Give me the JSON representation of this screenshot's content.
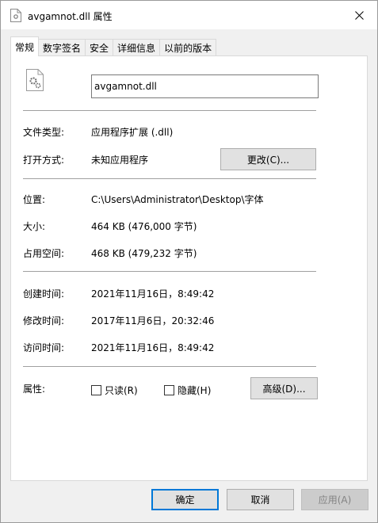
{
  "window": {
    "title": "avgamnot.dll 属性",
    "close_icon": "close-icon"
  },
  "tabs": [
    {
      "label": "常规",
      "active": true
    },
    {
      "label": "数字签名",
      "active": false
    },
    {
      "label": "安全",
      "active": false
    },
    {
      "label": "详细信息",
      "active": false
    },
    {
      "label": "以前的版本",
      "active": false
    }
  ],
  "general": {
    "filename": "avgamnot.dll",
    "file_type_label": "文件类型:",
    "file_type_value": "应用程序扩展 (.dll)",
    "opens_with_label": "打开方式:",
    "opens_with_value": "未知应用程序",
    "change_button": "更改(C)...",
    "location_label": "位置:",
    "location_value": "C:\\Users\\Administrator\\Desktop\\字体",
    "size_label": "大小:",
    "size_value": "464 KB (476,000 字节)",
    "disk_size_label": "占用空间:",
    "disk_size_value": "468 KB (479,232 字节)",
    "created_label": "创建时间:",
    "created_value": "2021年11月16日，8:49:42",
    "modified_label": "修改时间:",
    "modified_value": "2017年11月6日，20:32:46",
    "accessed_label": "访问时间:",
    "accessed_value": "2021年11月16日，8:49:42",
    "attributes_label": "属性:",
    "readonly_label": "只读(R)",
    "hidden_label": "隐藏(H)",
    "advanced_button": "高级(D)..."
  },
  "footer": {
    "ok": "确定",
    "cancel": "取消",
    "apply": "应用(A)"
  },
  "colors": {
    "default_button_border": "#0078d7",
    "panel_bg": "#ffffff",
    "window_bg": "#f0f0f0"
  }
}
